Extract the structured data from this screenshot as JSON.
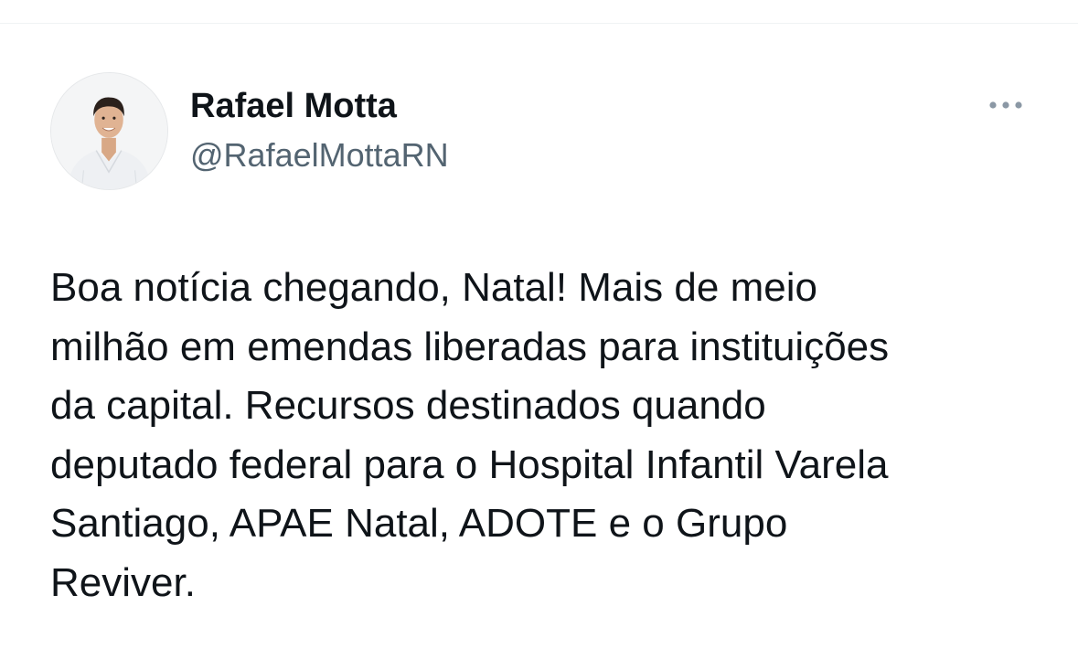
{
  "tweet": {
    "author": {
      "display_name": "Rafael Motta",
      "handle": "@RafaelMottaRN"
    },
    "menu_icon": "more-horizontal-icon",
    "text_lines": [
      "Boa notícia chegando, Natal! Mais de meio",
      "milhão em emendas liberadas para instituições",
      "da capital. Recursos destinados quando",
      "deputado federal para o Hospital Infantil Varela",
      "Santiago, APAE Natal, ADOTE e o Grupo",
      "Reviver."
    ]
  },
  "colors": {
    "text_primary": "#0f1419",
    "text_secondary": "#536471",
    "divider": "#eff3f4",
    "icon_muted": "#8b98a5"
  }
}
